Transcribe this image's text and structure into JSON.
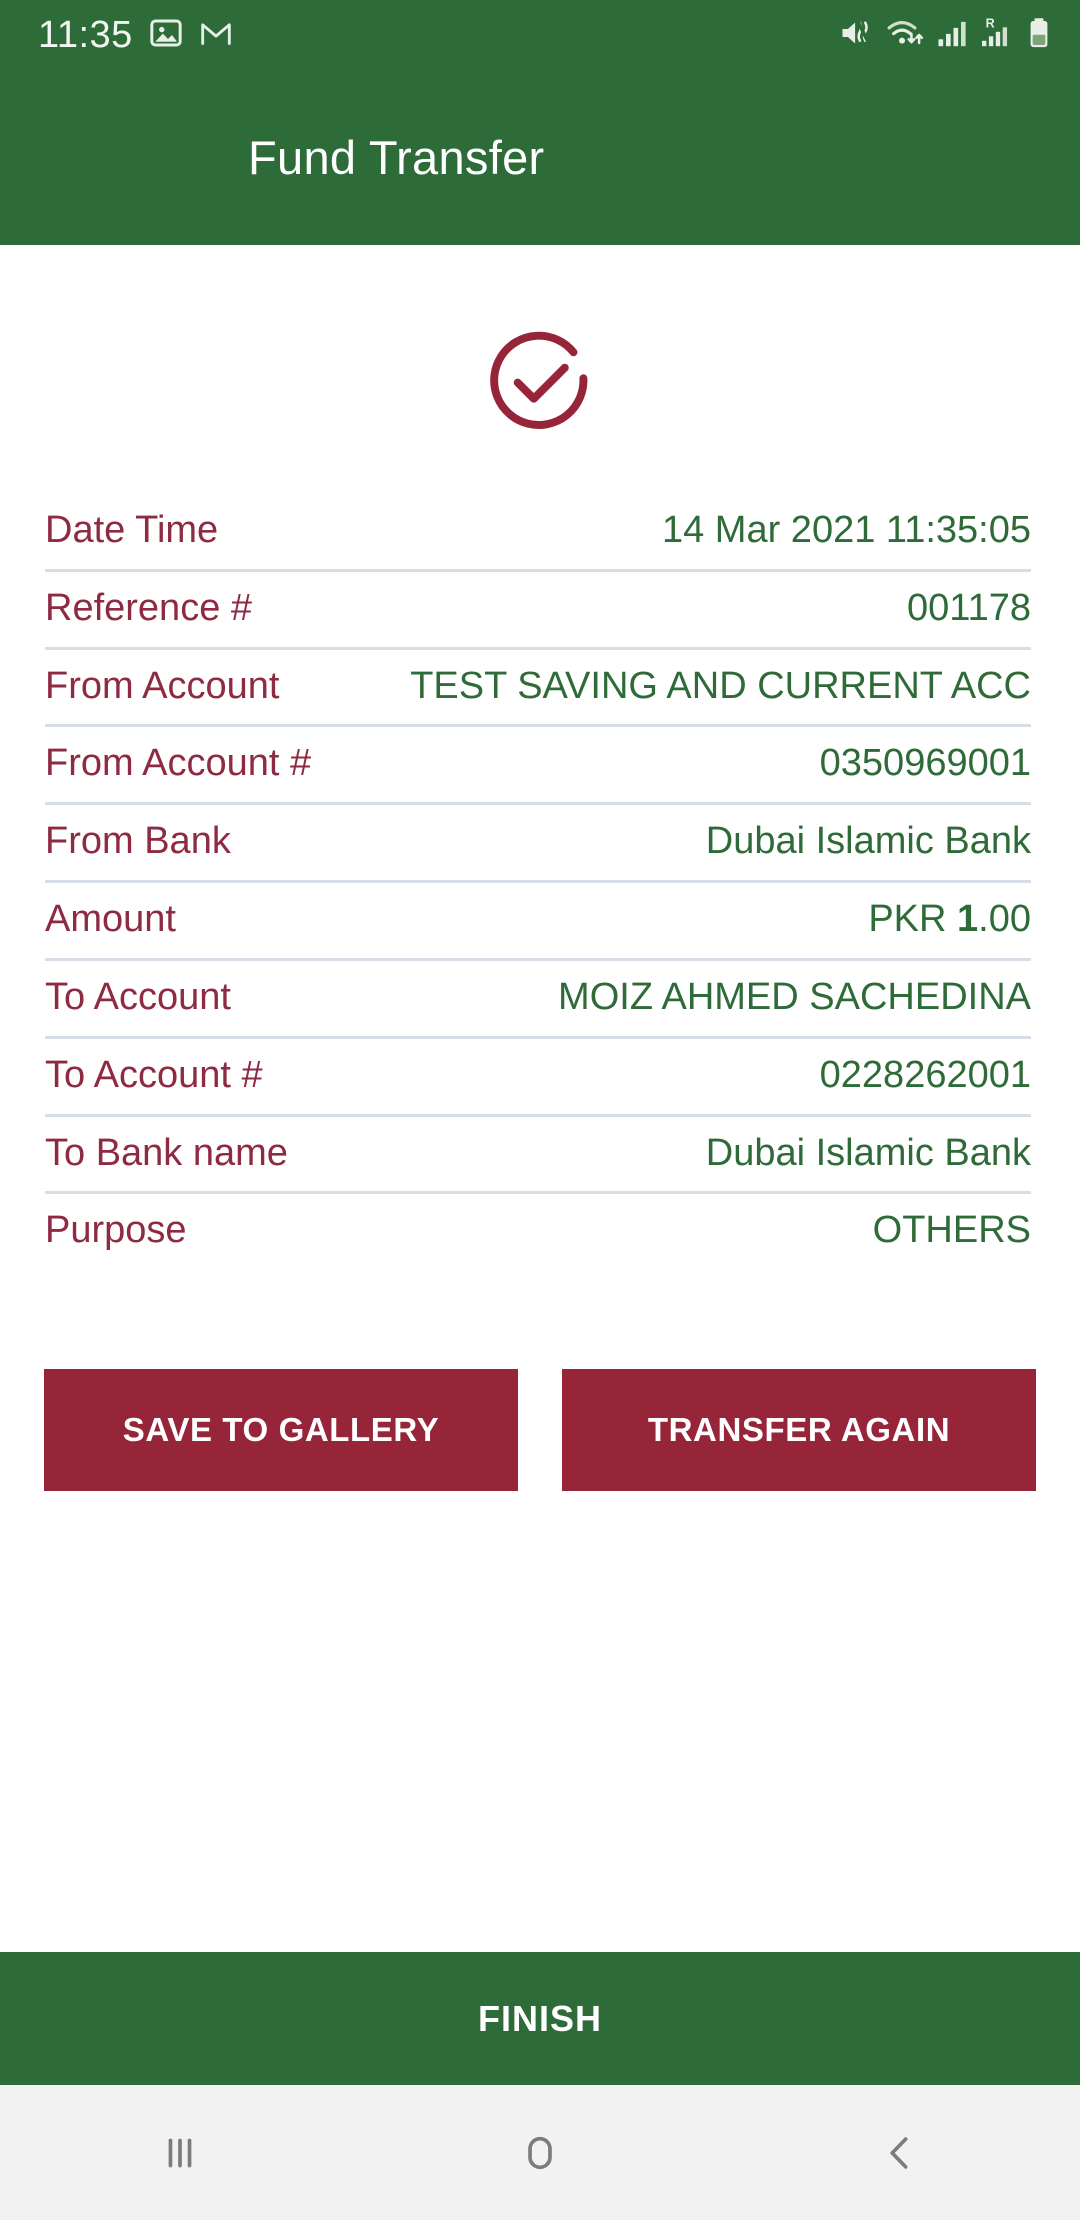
{
  "status_bar": {
    "time": "11:35",
    "left_icons": [
      {
        "name": "gallery-icon"
      },
      {
        "name": "gmail-icon"
      }
    ],
    "right_icons": [
      {
        "name": "mute-vibrate-icon"
      },
      {
        "name": "wifi-icon"
      },
      {
        "name": "cellular-signal-icon"
      },
      {
        "name": "roaming-signal-icon",
        "badge": "R"
      },
      {
        "name": "battery-icon"
      }
    ]
  },
  "app_bar": {
    "title": "Fund Transfer"
  },
  "status": {
    "icon": "success-check-circle-icon"
  },
  "details": [
    {
      "label": "Date Time",
      "value": "14 Mar 2021 11:35:05"
    },
    {
      "label": "Reference #",
      "value": "001178"
    },
    {
      "label": "From Account",
      "value": "TEST SAVING AND CURRENT ACC"
    },
    {
      "label": "From Account #",
      "value": "0350969001"
    },
    {
      "label": "From Bank",
      "value": "Dubai Islamic Bank"
    },
    {
      "label": "Amount",
      "value": "PKR 1.00",
      "amount_currency": "PKR ",
      "amount_major": "1",
      "amount_minor": ".00"
    },
    {
      "label": "To Account",
      "value": "MOIZ AHMED SACHEDINA"
    },
    {
      "label": "To Account #",
      "value": "0228262001"
    },
    {
      "label": "To Bank name",
      "value": "Dubai Islamic Bank"
    },
    {
      "label": "Purpose",
      "value": "OTHERS"
    }
  ],
  "actions": {
    "save_to_gallery": "SAVE TO GALLERY",
    "transfer_again": "TRANSFER AGAIN"
  },
  "finish": {
    "label": "FINISH"
  },
  "nav_bar": {
    "recents": "recents-icon",
    "home": "home-icon",
    "back": "back-icon"
  },
  "colors": {
    "brand_green": "#2D6B38",
    "brand_maroon": "#97253A",
    "label_maroon": "#8E2A41",
    "value_green": "#2E6B38",
    "divider": "#D6DEE8",
    "nav_background": "#f1f2f1"
  }
}
